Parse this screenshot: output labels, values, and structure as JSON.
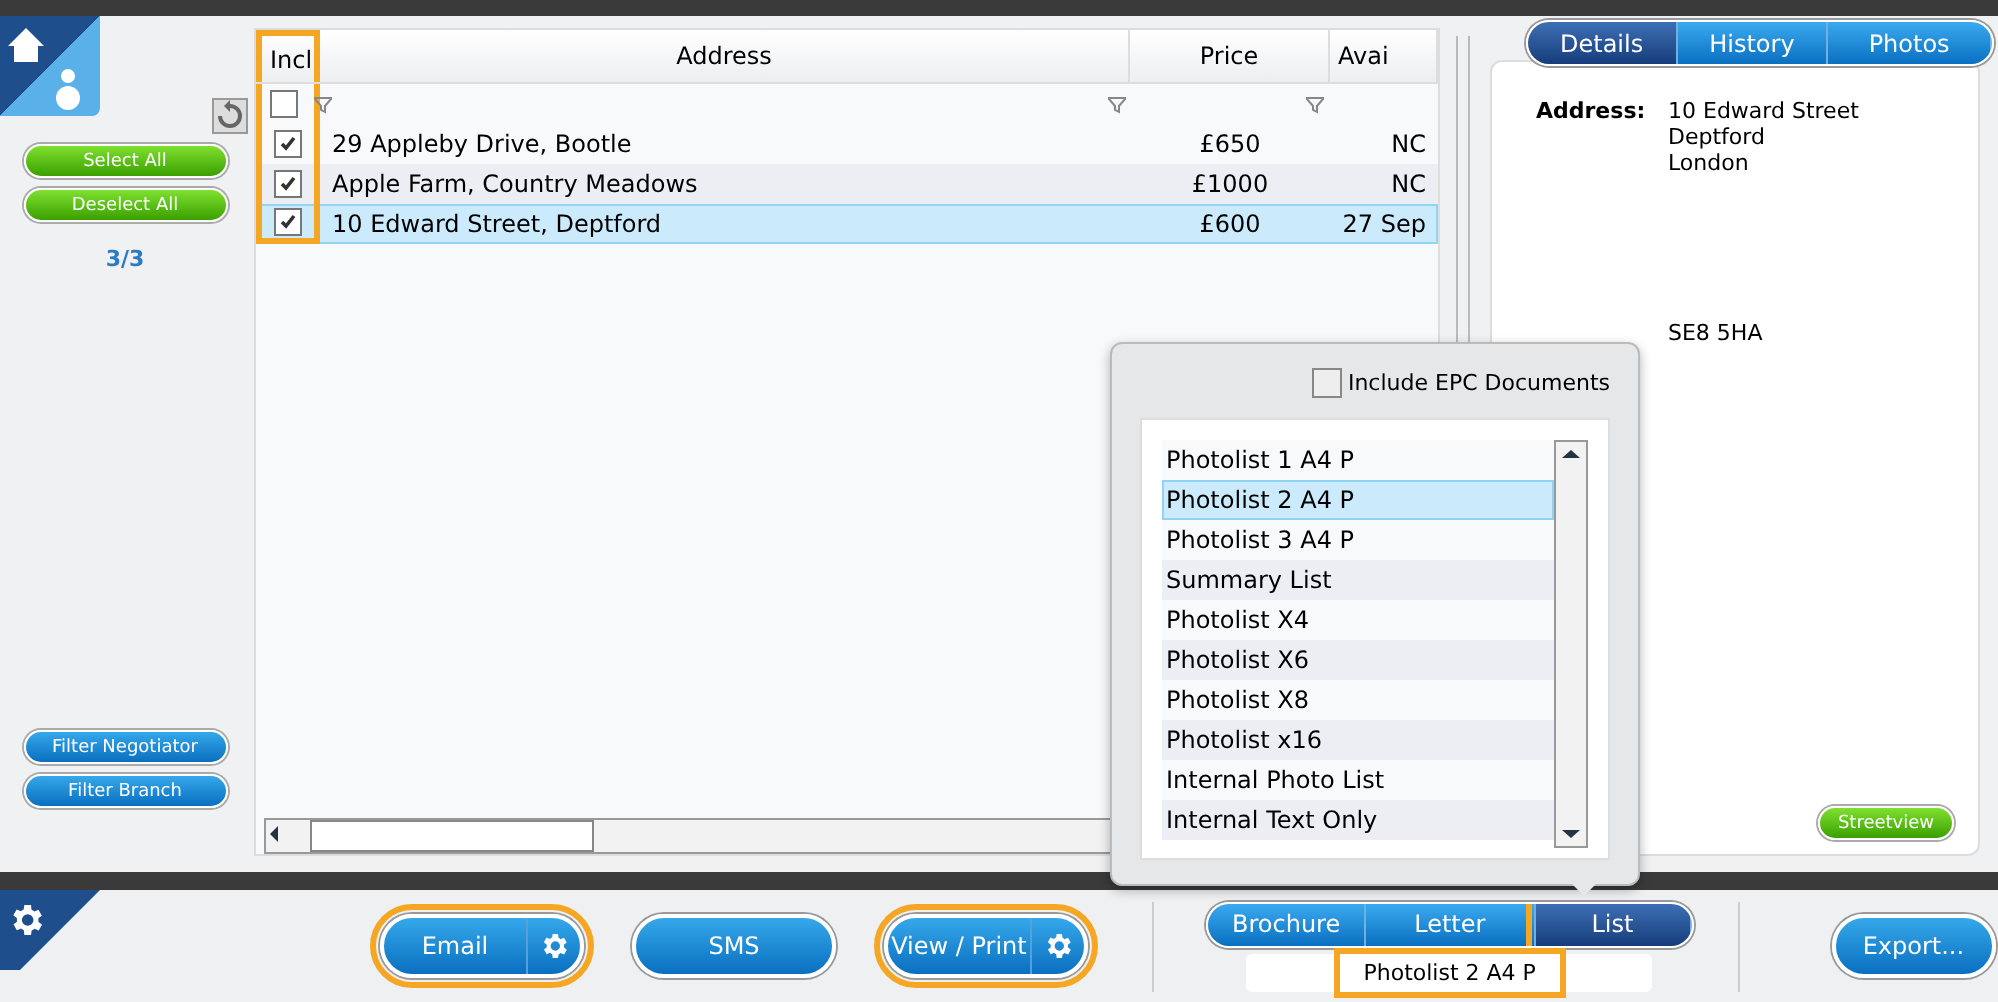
{
  "sidebar": {
    "select_buttons": [
      {
        "label": "Select All"
      },
      {
        "label": "Deselect All"
      }
    ],
    "count": "3/3",
    "filter_buttons": [
      {
        "label": "Filter Negotiator"
      },
      {
        "label": "Filter Branch"
      }
    ]
  },
  "grid": {
    "columns": [
      {
        "label": "Incl",
        "highlighted": true
      },
      {
        "label": "Address",
        "highlighted": false
      },
      {
        "label": "Price",
        "highlighted": false
      },
      {
        "label": "Avai",
        "highlighted": false
      }
    ],
    "filter_checked": false,
    "rows": [
      {
        "checked": true,
        "address": "29 Appleby Drive, Bootle",
        "price": "£650",
        "available": "NC",
        "selected": false
      },
      {
        "checked": true,
        "address": "Apple Farm, Country Meadows",
        "price": "£1000",
        "available": "NC",
        "selected": false
      },
      {
        "checked": true,
        "address": "10 Edward Street, Deptford",
        "price": "£600",
        "available": "27 Sep",
        "selected": true
      }
    ]
  },
  "details": {
    "tabs": [
      {
        "label": "Details",
        "selected": true
      },
      {
        "label": "History",
        "selected": false
      },
      {
        "label": "Photos",
        "selected": false
      }
    ],
    "address_label": "Address:",
    "address_lines": [
      "10 Edward Street",
      "Deptford",
      "London"
    ],
    "postcode": "SE8 5HA",
    "streetview": "Streetview"
  },
  "popup": {
    "epc": {
      "label": "Include EPC Documents",
      "checked": false
    },
    "items": [
      {
        "label": "Photolist 1 A4 P",
        "selected": false
      },
      {
        "label": "Photolist 2 A4 P",
        "selected": true
      },
      {
        "label": "Photolist 3 A4 P",
        "selected": false
      },
      {
        "label": "Summary List",
        "selected": false
      },
      {
        "label": "Photolist X4",
        "selected": false
      },
      {
        "label": "Photolist X6",
        "selected": false
      },
      {
        "label": "Photolist X8",
        "selected": false
      },
      {
        "label": "Photolist x16",
        "selected": false
      },
      {
        "label": "Internal Photo List",
        "selected": false
      },
      {
        "label": "Internal Text Only",
        "selected": false
      }
    ]
  },
  "toolbar": {
    "actions": [
      {
        "label": "Email",
        "kind": "gear",
        "highlighted": true
      },
      {
        "label": "SMS",
        "kind": "plain",
        "highlighted": false
      },
      {
        "label": "View / Print",
        "kind": "gear",
        "highlighted": true
      }
    ],
    "doc_tabs": [
      {
        "label": "Brochure",
        "selected": false,
        "highlighted": false
      },
      {
        "label": "Letter",
        "selected": false,
        "highlighted": false
      },
      {
        "label": "List",
        "selected": true,
        "highlighted": true
      }
    ],
    "chosen": {
      "value": "Photolist 2 A4 P",
      "highlighted": true
    },
    "export": "Export..."
  }
}
